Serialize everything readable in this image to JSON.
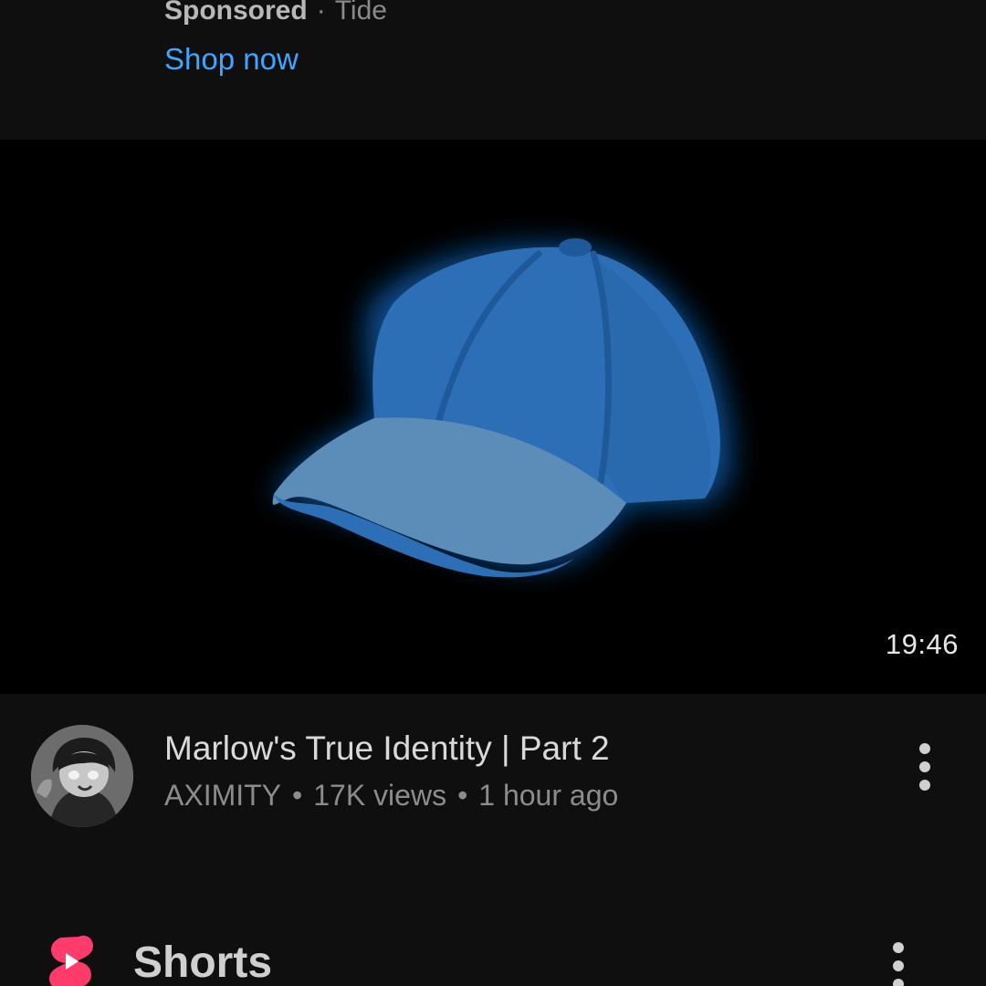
{
  "ad": {
    "sponsored_label": "Sponsored",
    "separator": "·",
    "advertiser": "Tide",
    "cta_label": "Shop now"
  },
  "video": {
    "thumbnail_icon": "baseball-cap-icon",
    "duration": "19:46",
    "title": "Marlow's True Identity | Part 2",
    "channel": "AXIMITY",
    "separator": "•",
    "views": "17K views",
    "age": "1 hour ago",
    "menu_icon": "more-vert-icon"
  },
  "shorts": {
    "logo_icon": "shorts-logo-icon",
    "title": "Shorts",
    "menu_icon": "more-vert-icon"
  },
  "colors": {
    "background": "#0f0f0f",
    "link": "#3ea6ff",
    "shorts_red": "#ff3b6b",
    "cap_crown": "#2d6fb6",
    "cap_brim": "#5b8db8"
  }
}
